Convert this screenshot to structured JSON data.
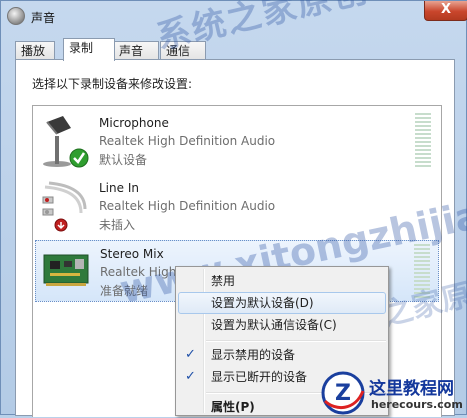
{
  "window": {
    "title": "声音",
    "close_label": "X"
  },
  "tabs": [
    {
      "label": "播放"
    },
    {
      "label": "录制"
    },
    {
      "label": "声音"
    },
    {
      "label": "通信"
    }
  ],
  "panel": {
    "instruction": "选择以下录制设备来修改设置:"
  },
  "devices": [
    {
      "name": "Microphone",
      "driver": "Realtek High Definition Audio",
      "status": "默认设备"
    },
    {
      "name": "Line In",
      "driver": "Realtek High Definition Audio",
      "status": "未插入"
    },
    {
      "name": "Stereo Mix",
      "driver": "Realtek High Definition Audio",
      "status": "准备就绪"
    }
  ],
  "context_menu": {
    "items": [
      {
        "label": "禁用"
      },
      {
        "label": "设置为默认设备(D)"
      },
      {
        "label": "设置为默认通信设备(C)"
      },
      {
        "label": "显示禁用的设备",
        "checked": true
      },
      {
        "label": "显示已断开的设备",
        "checked": true
      },
      {
        "label": "属性(P)"
      }
    ],
    "check_glyph": "✓"
  },
  "watermarks": {
    "top": "系统之家原创www",
    "middle": "www.xitongzhijia.net",
    "bottom": "系统之家原创 www"
  },
  "logo": {
    "name": "这里教程网",
    "url": "herecours.com",
    "mark_letter": "Z"
  }
}
